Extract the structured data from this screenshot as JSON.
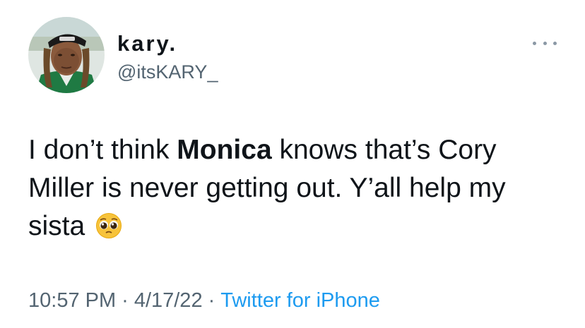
{
  "author": {
    "display_name": "kary.",
    "handle": "@itsKARY_",
    "avatar_icon": "profile-photo"
  },
  "tweet": {
    "text_part1": "I don’t think ",
    "text_bold": "Monica",
    "text_part2": " knows that’s Cory Miller is never getting out. Y’all help my sista ",
    "emoji": "pleading-face-emoji"
  },
  "meta": {
    "time": "10:57 PM",
    "date": "4/17/22",
    "separator": "·",
    "source": "Twitter for iPhone"
  },
  "colors": {
    "link": "#1d9bf0",
    "secondary_text": "#536471",
    "primary_text": "#0f1419"
  }
}
